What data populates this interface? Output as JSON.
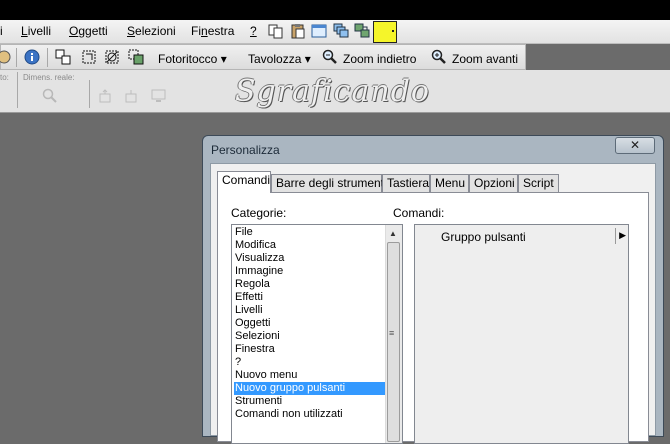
{
  "menubar": {
    "items": [
      {
        "pre": "",
        "ul": "",
        "post": "i"
      },
      {
        "pre": "",
        "ul": "L",
        "post": "ivelli"
      },
      {
        "pre": "",
        "ul": "O",
        "post": "ggetti"
      },
      {
        "pre": "",
        "ul": "S",
        "post": "elezioni"
      },
      {
        "pre": "Fi",
        "ul": "n",
        "post": "estra"
      },
      {
        "pre": "",
        "ul": "?",
        "post": ""
      }
    ],
    "icons": [
      "copy-icon",
      "paste-icon",
      "window-icon",
      "cascade-icon",
      "layers-icon"
    ]
  },
  "toolbar1": {
    "fotoritocco": "Fotoritocco",
    "tavolozza": "Tavolozza",
    "zoom_out": "Zoom indietro",
    "zoom_in": "Zoom avanti",
    "dropdown_glyph": "▾"
  },
  "toolbar2": {
    "label_left": "to:",
    "label_dimens": "Dimens. reale:"
  },
  "watermark": "Sgraficando",
  "dialog": {
    "title": "Personalizza",
    "close_glyph": "✕",
    "tabs": [
      "Comandi",
      "Barre degli strumenti",
      "Tastiera",
      "Menu",
      "Opzioni",
      "Script"
    ],
    "active_tab": "Comandi",
    "categories_label": "Categorie:",
    "commands_label": "Comandi:",
    "categories": [
      "File",
      "Modifica",
      "Visualizza",
      "Immagine",
      "Regola",
      "Effetti",
      "Livelli",
      "Oggetti",
      "Selezioni",
      "Finestra",
      "?",
      "Nuovo menu",
      "Nuovo gruppo pulsanti",
      "Strumenti",
      "Comandi non utilizzati"
    ],
    "selected_category": "Nuovo gruppo pulsanti",
    "commands": [
      "Gruppo pulsanti"
    ]
  },
  "colors": {
    "highlight": "#3399ff",
    "yellow_button": "#f5f52a"
  }
}
